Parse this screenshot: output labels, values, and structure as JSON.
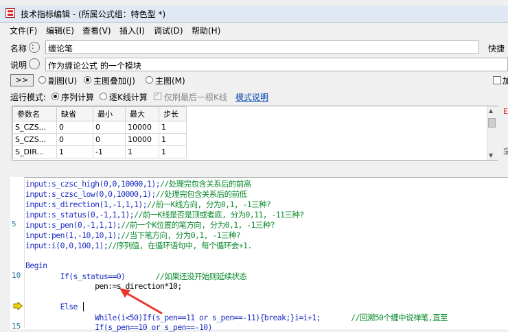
{
  "window": {
    "title": "技术指标编辑 - (所属公式组：特色型 *)"
  },
  "menu": [
    "文件(F)",
    "编辑(E)",
    "查看(V)",
    "插入(I)",
    "调试(D)",
    "帮助(H)"
  ],
  "form": {
    "name_label": "名称",
    "name_value": "缠论笔",
    "quick_label": "快捷",
    "desc_label": "说明",
    "desc_value": "作为缠论公式 的一个模块",
    "expand_label": ">>",
    "chart_options": [
      "副图(U)",
      "主图叠加(J)",
      "主图(M)"
    ],
    "chart_selected": "主图叠加(J)",
    "right_check_label": "加",
    "run_mode_label": "运行模式:",
    "run_options": [
      "序列计算",
      "逐K线计算"
    ],
    "run_selected": "序列计算",
    "last_bar_check": "仅刷最后一根K线",
    "mode_help_link": "模式说明",
    "side_letter": "E",
    "side_char": "尘"
  },
  "params": {
    "headers": [
      "参数名",
      "缺省",
      "最小",
      "最大",
      "步长"
    ],
    "rows": [
      [
        "S_CZS...",
        "0",
        "0",
        "10000",
        "1"
      ],
      [
        "S_CZS...",
        "0",
        "0",
        "10000",
        "1"
      ],
      [
        "S_DIR...",
        "1",
        "-1",
        "1",
        "1"
      ]
    ]
  },
  "code": {
    "line_numbers": [
      "5",
      "10",
      "15"
    ],
    "lines": [
      {
        "code": "input:s_czsc_high(0,0,10000,1);",
        "comment": "//处理完包含关系后的前高"
      },
      {
        "code": "input:s_czsc_low(0,0,10000,1);",
        "comment": "//处理完包含关系后的前低"
      },
      {
        "code": "input:s_direction(1,-1,1,1);",
        "comment": "//前一K线方向, 分为0,1, -1三种?"
      },
      {
        "code": "input:s_status(0,-1,1,1);",
        "comment": "//前一K线是否是顶或者底, 分为0,11, -11三种?"
      },
      {
        "code": "input:s_pen(0,-1,1,1);",
        "comment": "//前一个K位置的笔方向, 分为0,1, -1三种?"
      },
      {
        "code": "input:pen(1,-10,10,1);",
        "comment": "//当下笔方向, 分为0,1, -1三种?"
      },
      {
        "code": "input:i(0,0,100,1);",
        "comment": "//序列值, 在循环语句中, 每个循环会+1."
      },
      {
        "code": "Begin",
        "comment": ""
      },
      {
        "code": "        If(s_status==0)",
        "comment": "       //如果还没开始则延续状态"
      },
      {
        "code": "                pen:=s_direction*10;",
        "comment": ""
      },
      {
        "code": "        Else",
        "comment": ""
      },
      {
        "code": "                While(i<50)If(s_pen==11 or s_pen==-11){break;}i=i+1;",
        "comment": "       //回溯50个缠中说禅笔,直至"
      },
      {
        "code": "                If(s_pen==10 or s_pen==-10)",
        "comment": ""
      }
    ]
  },
  "colors": {
    "keyword": "#1c2ec2",
    "comment": "#0b8a2d",
    "arrow": "#e8372a",
    "marker": "#f2d200"
  }
}
